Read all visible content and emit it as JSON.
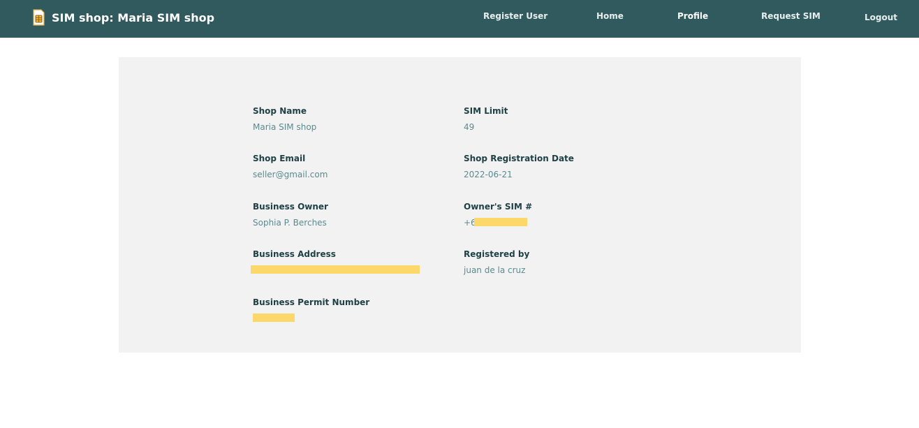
{
  "nav": {
    "brand": "SIM shop: Maria SIM shop",
    "brand_icon": "sim-card-icon",
    "links": [
      "Register User",
      "Home",
      "Profile",
      "Request SIM",
      "Logout"
    ],
    "active": "Profile",
    "bg_color": "#315a5f"
  },
  "profile": {
    "shop_name_label": "Shop Name",
    "shop_name": "Maria SIM shop",
    "sim_limit_label": "SIM Limit",
    "sim_limit": "49",
    "shop_email_label": "Shop Email",
    "shop_email": "seller@gmail.com",
    "registration_date_label": "Shop Registration Date",
    "registration_date": "2022-06-21",
    "business_owner_label": "Business Owner",
    "business_owner": "Sophia P. Berches",
    "owner_sim_label": "Owner's SIM #",
    "owner_sim_prefix": "+6",
    "business_address_label": "Business Address",
    "registered_by_label": "Registered by",
    "registered_by": "juan de la cruz",
    "business_permit_label": "Business Permit Number"
  },
  "colors": {
    "accent": "#315a5f",
    "card_bg": "#f2f2f2",
    "redaction": "#fcd86a"
  }
}
